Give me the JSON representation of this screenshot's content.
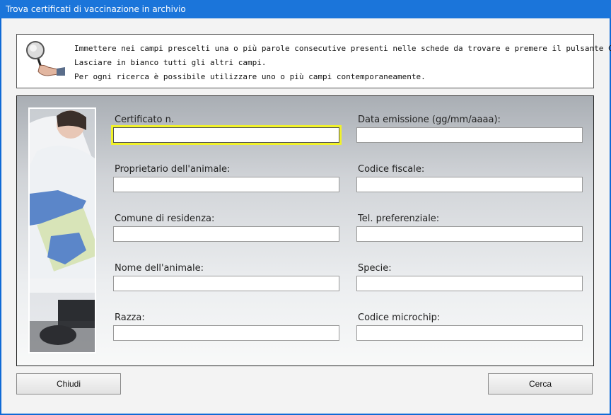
{
  "window": {
    "title": "Trova certificati di vaccinazione in archivio"
  },
  "info": {
    "lines": [
      "Immettere nei campi prescelti una o più parole consecutive presenti nelle schede da trovare e premere il pulsante Cerca.",
      "Lasciare in bianco tutti gli altri campi.",
      "Per ogni ricerca è possibile utilizzare uno o più campi contemporaneamente."
    ]
  },
  "fields": {
    "certificato": {
      "label": "Certificato n.",
      "value": ""
    },
    "data_emissione": {
      "label": "Data emissione (gg/mm/aaaa):",
      "value": ""
    },
    "proprietario": {
      "label": "Proprietario dell'animale:",
      "value": ""
    },
    "codice_fiscale": {
      "label": "Codice fiscale:",
      "value": ""
    },
    "comune": {
      "label": "Comune di residenza:",
      "value": ""
    },
    "telefono": {
      "label": "Tel. preferenziale:",
      "value": ""
    },
    "nome_animale": {
      "label": "Nome dell'animale:",
      "value": ""
    },
    "specie": {
      "label": "Specie:",
      "value": ""
    },
    "razza": {
      "label": "Razza:",
      "value": ""
    },
    "microchip": {
      "label": "Codice microchip:",
      "value": ""
    }
  },
  "buttons": {
    "close": "Chiudi",
    "search": "Cerca"
  },
  "icons": {
    "info": "magnifier-hand-icon",
    "photo": "doctor-image"
  },
  "colors": {
    "titlebar": "#1b75da",
    "focus_border": "#f1f22a"
  }
}
